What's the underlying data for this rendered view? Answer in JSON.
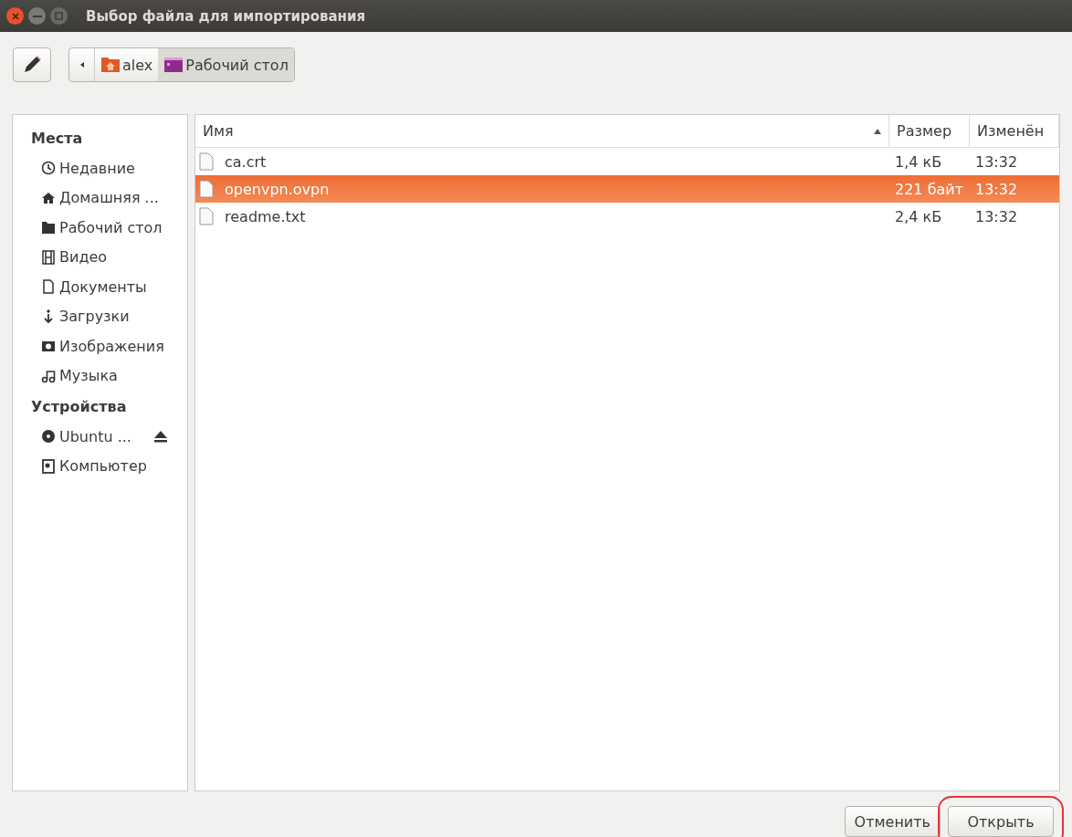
{
  "window": {
    "title": "Выбор файла для импортирования"
  },
  "path_bar": [
    {
      "label": "alex",
      "kind": "home",
      "selected": false
    },
    {
      "label": "Рабочий стол",
      "kind": "desktop",
      "selected": true
    }
  ],
  "sidebar": {
    "sections": [
      {
        "heading": "Места",
        "items": [
          {
            "label": "Недавние",
            "kind": "recent"
          },
          {
            "label": "Домашняя ...",
            "kind": "home"
          },
          {
            "label": "Рабочий стол",
            "kind": "folder"
          },
          {
            "label": "Видео",
            "kind": "video"
          },
          {
            "label": "Документы",
            "kind": "document"
          },
          {
            "label": "Загрузки",
            "kind": "download"
          },
          {
            "label": "Изображения",
            "kind": "camera"
          },
          {
            "label": "Музыка",
            "kind": "music"
          }
        ]
      },
      {
        "heading": "Устройства",
        "items": [
          {
            "label": "Ubuntu ...",
            "kind": "disc",
            "ejectable": true
          },
          {
            "label": "Компьютер",
            "kind": "computer"
          }
        ]
      }
    ]
  },
  "table": {
    "columns": [
      {
        "label": "Имя",
        "sorted": true
      },
      {
        "label": "Размер",
        "sorted": false
      },
      {
        "label": "Изменён",
        "sorted": false
      }
    ],
    "rows": [
      {
        "name": "ca.crt",
        "size": "1,4 кБ",
        "modified": "13:32",
        "selected": false
      },
      {
        "name": "openvpn.ovpn",
        "size": "221 байт",
        "modified": "13:32",
        "selected": true
      },
      {
        "name": "readme.txt",
        "size": "2,4 кБ",
        "modified": "13:32",
        "selected": false
      }
    ]
  },
  "buttons": [
    {
      "label": "Отменить",
      "highlighted": false
    },
    {
      "label": "Открыть",
      "highlighted": true
    }
  ]
}
